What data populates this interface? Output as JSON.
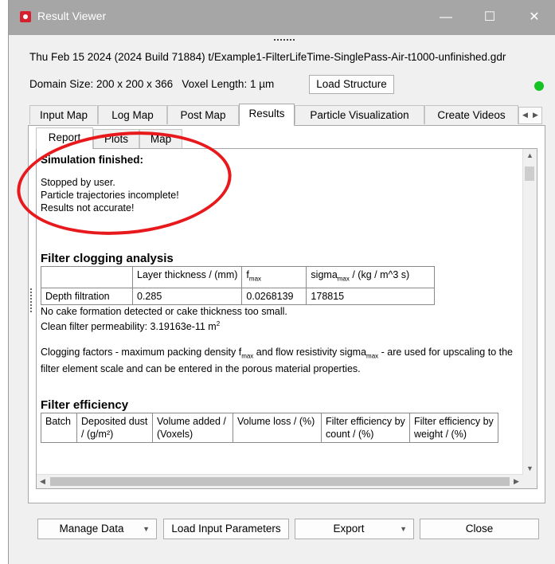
{
  "window": {
    "title": "Result Viewer",
    "controls": {
      "minimize": "—",
      "maximize": "☐",
      "close": "✕"
    }
  },
  "header": {
    "info_line": "Thu Feb 15 2024 (2024 Build 71884) t/Example1-FilterLifeTime-SinglePass-Air-t1000-unfinished.gdr",
    "domain_label": "Domain Size: 200 x 200 x 366",
    "voxel_label": "Voxel Length: 1 µm",
    "load_structure_label": "Load Structure",
    "status_color": "#16c322"
  },
  "tabs": [
    {
      "label": "Input Map"
    },
    {
      "label": "Log Map"
    },
    {
      "label": "Post Map"
    },
    {
      "label": "Results"
    },
    {
      "label": "Particle Visualization"
    },
    {
      "label": "Create Videos"
    }
  ],
  "active_tab": "Results",
  "tab_scroll": {
    "left": "◀",
    "right": "▶"
  },
  "subtabs": [
    {
      "label": "Report"
    },
    {
      "label": "Plots"
    },
    {
      "label": "Map"
    }
  ],
  "active_subtab": "Report",
  "report": {
    "status_heading": "Simulation finished:",
    "status_lines": [
      "Stopped by user.",
      "Particle trajectories incomplete!",
      "Results not accurate!"
    ],
    "clogging": {
      "heading": "Filter clogging analysis",
      "col_thickness": "Layer thickness / (mm)",
      "col_fmax_base": "f",
      "col_fmax_sub": "max",
      "col_sigma_base": "sigma",
      "col_sigma_sub": "max",
      "col_sigma_unit": " / (kg / m^3 s)",
      "row_label": "Depth filtration",
      "thickness": "0.285",
      "fmax": "0.0268139",
      "sigma": "178815"
    },
    "note_cake": "No cake formation detected or cake thickness too small.",
    "note_perm_text": "Clean filter permeability: 3.19163e-11 m",
    "note_perm_sup": "2",
    "factors_a": "Clogging factors - maximum packing density f",
    "factors_sub1": "max",
    "factors_b": " and flow resistivity sigma",
    "factors_sub2": "max",
    "factors_c": " - are used for upscaling to the filter element scale and can be entered in the porous material properties.",
    "efficiency": {
      "heading": "Filter efficiency",
      "headers": [
        "Batch",
        "Deposited dust / (g/m²)",
        "Volume added / (Voxels)",
        "Volume loss / (%)",
        "Filter efficiency by count / (%)",
        "Filter efficiency by weight / (%)"
      ]
    }
  },
  "footer": {
    "manage_data": "Manage Data",
    "load_input": "Load Input Parameters",
    "export": "Export",
    "close": "Close"
  }
}
